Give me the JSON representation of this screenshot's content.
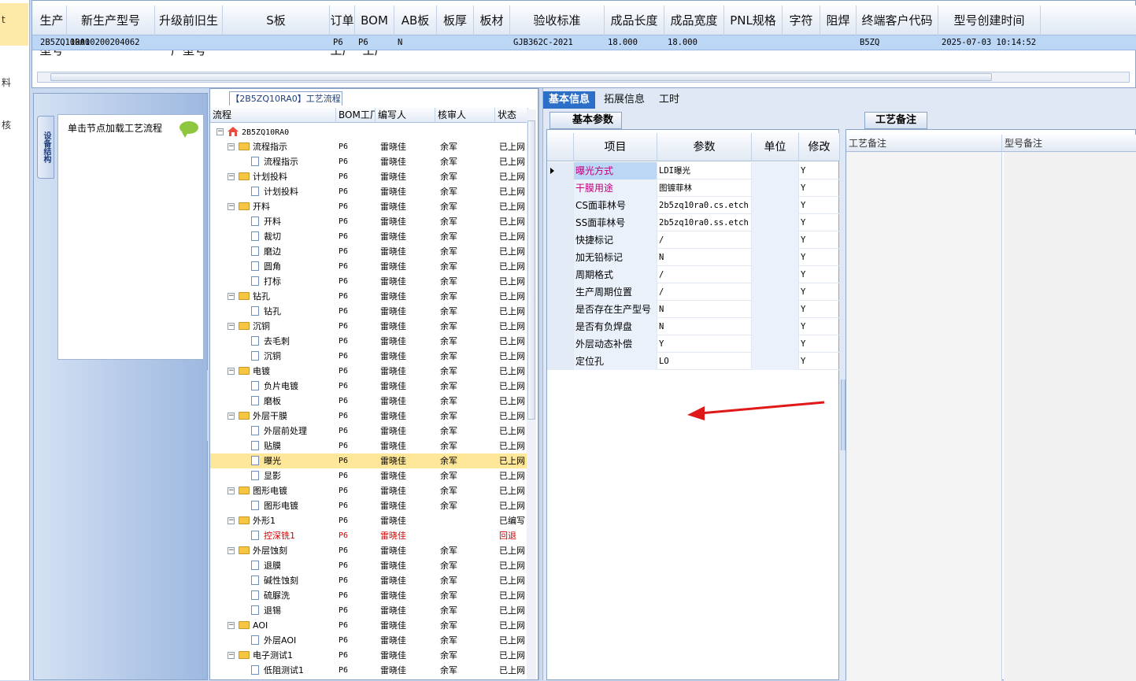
{
  "left_strip": {
    "items": [
      "t",
      "料",
      "核"
    ]
  },
  "top_grid": {
    "headers": [
      "生产型号",
      "新生产型号",
      "升级前旧生产型号",
      "S板",
      "订单工厂",
      "BOM工厂",
      "AB板",
      "板厚",
      "板材",
      "验收标准",
      "成品长度",
      "成品宽度",
      "PNL规格",
      "字符",
      "阻焊",
      "终端客户代码",
      "型号创建时间"
    ],
    "row": [
      "2B5ZQ10RA0",
      "10010200204062",
      "",
      "",
      "P6",
      "P6",
      "N",
      "",
      "",
      "GJB362C-2021",
      "18.000",
      "18.000",
      "",
      "",
      "",
      "B5ZQ",
      "2025-07-03 10:14:52"
    ]
  },
  "nav": {
    "vertical_tab": "设备结构",
    "card_label": "单击节点加载工艺流程"
  },
  "tree": {
    "title": "【2B5ZQ10RA0】工艺流程",
    "headers": [
      "流程",
      "BOM工厂",
      "编写人",
      "核审人",
      "状态"
    ],
    "rows": [
      {
        "name": "2B5ZQ10RA0",
        "bom": "",
        "writer": "",
        "reviewer": "",
        "status": ""
      },
      {
        "name": "流程指示",
        "bom": "P6",
        "writer": "雷晓佳",
        "reviewer": "余军",
        "status": "已上网"
      },
      {
        "name": "流程指示",
        "bom": "P6",
        "writer": "雷晓佳",
        "reviewer": "余军",
        "status": "已上网"
      },
      {
        "name": "计划投料",
        "bom": "P6",
        "writer": "雷晓佳",
        "reviewer": "余军",
        "status": "已上网"
      },
      {
        "name": "计划投料",
        "bom": "P6",
        "writer": "雷晓佳",
        "reviewer": "余军",
        "status": "已上网"
      },
      {
        "name": "开料",
        "bom": "P6",
        "writer": "雷晓佳",
        "reviewer": "余军",
        "status": "已上网"
      },
      {
        "name": "开料",
        "bom": "P6",
        "writer": "雷晓佳",
        "reviewer": "余军",
        "status": "已上网"
      },
      {
        "name": "裁切",
        "bom": "P6",
        "writer": "雷晓佳",
        "reviewer": "余军",
        "status": "已上网"
      },
      {
        "name": "磨边",
        "bom": "P6",
        "writer": "雷晓佳",
        "reviewer": "余军",
        "status": "已上网"
      },
      {
        "name": "圆角",
        "bom": "P6",
        "writer": "雷晓佳",
        "reviewer": "余军",
        "status": "已上网"
      },
      {
        "name": "打标",
        "bom": "P6",
        "writer": "雷晓佳",
        "reviewer": "余军",
        "status": "已上网"
      },
      {
        "name": "钻孔",
        "bom": "P6",
        "writer": "雷晓佳",
        "reviewer": "余军",
        "status": "已上网"
      },
      {
        "name": "钻孔",
        "bom": "P6",
        "writer": "雷晓佳",
        "reviewer": "余军",
        "status": "已上网"
      },
      {
        "name": "沉铜",
        "bom": "P6",
        "writer": "雷晓佳",
        "reviewer": "余军",
        "status": "已上网"
      },
      {
        "name": "去毛刺",
        "bom": "P6",
        "writer": "雷晓佳",
        "reviewer": "余军",
        "status": "已上网"
      },
      {
        "name": "沉铜",
        "bom": "P6",
        "writer": "雷晓佳",
        "reviewer": "余军",
        "status": "已上网"
      },
      {
        "name": "电镀",
        "bom": "P6",
        "writer": "雷晓佳",
        "reviewer": "余军",
        "status": "已上网"
      },
      {
        "name": "负片电镀",
        "bom": "P6",
        "writer": "雷晓佳",
        "reviewer": "余军",
        "status": "已上网"
      },
      {
        "name": "磨板",
        "bom": "P6",
        "writer": "雷晓佳",
        "reviewer": "余军",
        "status": "已上网"
      },
      {
        "name": "外层干膜",
        "bom": "P6",
        "writer": "雷晓佳",
        "reviewer": "余军",
        "status": "已上网"
      },
      {
        "name": "外层前处理",
        "bom": "P6",
        "writer": "雷晓佳",
        "reviewer": "余军",
        "status": "已上网"
      },
      {
        "name": "贴膜",
        "bom": "P6",
        "writer": "雷晓佳",
        "reviewer": "余军",
        "status": "已上网"
      },
      {
        "name": "曝光",
        "bom": "P6",
        "writer": "雷晓佳",
        "reviewer": "余军",
        "status": "已上网"
      },
      {
        "name": "显影",
        "bom": "P6",
        "writer": "雷晓佳",
        "reviewer": "余军",
        "status": "已上网"
      },
      {
        "name": "图形电镀",
        "bom": "P6",
        "writer": "雷晓佳",
        "reviewer": "余军",
        "status": "已上网"
      },
      {
        "name": "图形电镀",
        "bom": "P6",
        "writer": "雷晓佳",
        "reviewer": "余军",
        "status": "已上网"
      },
      {
        "name": "外形1",
        "bom": "P6",
        "writer": "雷晓佳",
        "reviewer": "",
        "status": "已编写"
      },
      {
        "name": "控深铣1",
        "bom": "P6",
        "writer": "雷晓佳",
        "reviewer": "",
        "status": "回退"
      },
      {
        "name": "外层蚀刻",
        "bom": "P6",
        "writer": "雷晓佳",
        "reviewer": "余军",
        "status": "已上网"
      },
      {
        "name": "退膜",
        "bom": "P6",
        "writer": "雷晓佳",
        "reviewer": "余军",
        "status": "已上网"
      },
      {
        "name": "碱性蚀刻",
        "bom": "P6",
        "writer": "雷晓佳",
        "reviewer": "余军",
        "status": "已上网"
      },
      {
        "name": "硫脲洗",
        "bom": "P6",
        "writer": "雷晓佳",
        "reviewer": "余军",
        "status": "已上网"
      },
      {
        "name": "退锡",
        "bom": "P6",
        "writer": "雷晓佳",
        "reviewer": "余军",
        "status": "已上网"
      },
      {
        "name": "AOI",
        "bom": "P6",
        "writer": "雷晓佳",
        "reviewer": "余军",
        "status": "已上网"
      },
      {
        "name": "外层AOI",
        "bom": "P6",
        "writer": "雷晓佳",
        "reviewer": "余军",
        "status": "已上网"
      },
      {
        "name": "电子测试1",
        "bom": "P6",
        "writer": "雷晓佳",
        "reviewer": "余军",
        "status": "已上网"
      },
      {
        "name": "低阻测试1",
        "bom": "P6",
        "writer": "雷晓佳",
        "reviewer": "余军",
        "status": "已上网"
      }
    ]
  },
  "right": {
    "tabs": [
      "基本信息",
      "拓展信息",
      "工时"
    ],
    "subtab": "基本参数",
    "param_headers": [
      "项目",
      "参数",
      "单位",
      "修改"
    ],
    "params": [
      {
        "item": "曝光方式",
        "value": "LDI曝光",
        "unit": "",
        "edit": "Y"
      },
      {
        "item": "干膜用途",
        "value": "图镀菲林",
        "unit": "",
        "edit": "Y"
      },
      {
        "item": "CS面菲林号",
        "value": "2b5zq10ra0.cs.etch",
        "unit": "",
        "edit": "Y"
      },
      {
        "item": "SS面菲林号",
        "value": "2b5zq10ra0.ss.etch",
        "unit": "",
        "edit": "Y"
      },
      {
        "item": "快捷标记",
        "value": "/",
        "unit": "",
        "edit": "Y"
      },
      {
        "item": "加无铅标记",
        "value": "N",
        "unit": "",
        "edit": "Y"
      },
      {
        "item": "周期格式",
        "value": "/",
        "unit": "",
        "edit": "Y"
      },
      {
        "item": "生产周期位置",
        "value": "/",
        "unit": "",
        "edit": "Y"
      },
      {
        "item": "是否存在生产型号",
        "value": "N",
        "unit": "",
        "edit": "Y"
      },
      {
        "item": "是否有负焊盘",
        "value": "N",
        "unit": "",
        "edit": "Y"
      },
      {
        "item": "外层动态补偿",
        "value": "Y",
        "unit": "",
        "edit": "Y"
      },
      {
        "item": "定位孔",
        "value": "LO",
        "unit": "",
        "edit": "Y"
      }
    ],
    "notes_tab": "工艺备注",
    "notes_headers": [
      "工艺备注",
      "型号备注"
    ]
  },
  "colors": {
    "accent": "#2c6fc9",
    "selected_row": "#ffe79a",
    "grid_select": "#bcd6f5",
    "red": "#d00000",
    "magenta_label": "#c0007a"
  }
}
